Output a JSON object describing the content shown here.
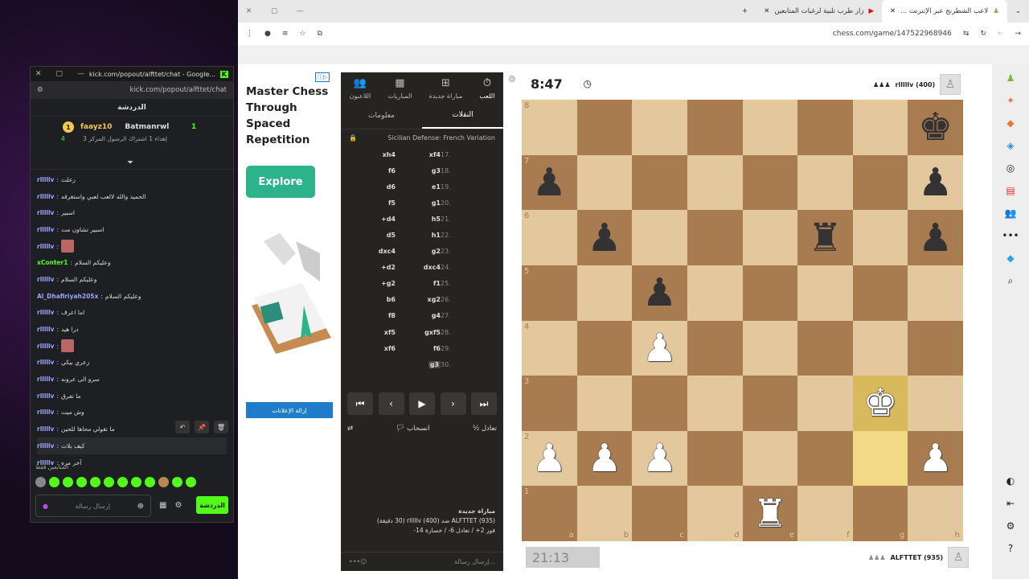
{
  "kick": {
    "window_title": "kick.com/popout/alfttet/chat - Google...",
    "url": "kick.com/popout/alfttet/chat",
    "header": "الدردشة",
    "pinned": {
      "rank": "1",
      "user1": "faayz10",
      "count1": "4",
      "user2": "Batmanrwl",
      "count2": "1",
      "gift_text": "إهداء 1 اشتراك الرسول المركز 3"
    },
    "messages": [
      {
        "user": "rlllllv",
        "text": "زعلت"
      },
      {
        "user": "rlllllv",
        "text": "الحميد والله لالعب لعبي واستغرقه"
      },
      {
        "user": "rlllllv",
        "text": "اسبير"
      },
      {
        "user": "rlllllv",
        "text": "اسبير تشاون مت"
      },
      {
        "user": "rlllllv",
        "text": ""
      },
      {
        "user": "xConter1",
        "text": "وعليكم السلام"
      },
      {
        "user": "rlllllv",
        "text": "وعليكم السلام"
      },
      {
        "user": "Al_Dhafiriyah205x",
        "text": "وعليكم السلام"
      },
      {
        "user": "rlllllv",
        "text": "اما اعرف"
      },
      {
        "user": "rlllllv",
        "text": "درا هيد"
      },
      {
        "user": "rlllllv",
        "text": ""
      },
      {
        "user": "rlllllv",
        "text": "زعري بيكي"
      },
      {
        "user": "rlllllv",
        "text": "سرو الى عرونه"
      },
      {
        "user": "rlllllv",
        "text": "ما تفرق"
      },
      {
        "user": "rlllllv",
        "text": "وش ميت"
      },
      {
        "user": "rlllllv",
        "text": "ما تقولي محاها للحين"
      },
      {
        "user": "rlllllv",
        "text": "كيف بلات"
      },
      {
        "user": "rlllllv",
        "text": "آخر مره"
      }
    ],
    "followers_label": "المتابعين فقط",
    "input_placeholder": "إرسال رسالة",
    "send_label": "الدردشة"
  },
  "browser": {
    "tabs": [
      {
        "label": "لاعب الشطرنج عبر الإنترنت ..."
      },
      {
        "label": "زار طرب تلبية لرغبات المتابعين"
      }
    ],
    "url": "chess.com/game/147522968946"
  },
  "ad": {
    "headline": "Master Chess Through Spaced Repetition",
    "button": "Explore",
    "remove": "إزالة الإعلانات"
  },
  "panel": {
    "tabs": [
      {
        "label": "اللعب",
        "icon": "stopwatch-icon"
      },
      {
        "label": "مباراة جديدة",
        "icon": "plus-icon"
      },
      {
        "label": "المباريات",
        "icon": "board-icon"
      },
      {
        "label": "اللاعبون",
        "icon": "players-icon"
      }
    ],
    "subtabs": [
      "النقلات",
      "معلومات"
    ],
    "opening": "Sicilian Defense: French Variation",
    "moves": [
      {
        "n": "17.",
        "w": "xf4",
        "b": "xh4"
      },
      {
        "n": "18.",
        "w": "g3",
        "b": "f6"
      },
      {
        "n": "19.",
        "w": "e1",
        "b": "d6"
      },
      {
        "n": "20.",
        "w": "g1",
        "b": "f5"
      },
      {
        "n": "21.",
        "w": "h5",
        "b": "+d4"
      },
      {
        "n": "22.",
        "w": "h1",
        "b": "d5"
      },
      {
        "n": "23.",
        "w": "g2",
        "b": "dxc4"
      },
      {
        "n": "24.",
        "w": "dxc4",
        "b": "+d2"
      },
      {
        "n": "25.",
        "w": "f1",
        "b": "+g2"
      },
      {
        "n": "26.",
        "w": "xg2",
        "b": "b6"
      },
      {
        "n": "27.",
        "w": "g4",
        "b": "f8"
      },
      {
        "n": "28.",
        "w": "gxf5",
        "b": "xf5"
      },
      {
        "n": "29.",
        "w": "f6",
        "b": "xf6"
      },
      {
        "n": "30.",
        "w": "g3",
        "b": ""
      }
    ],
    "draw": "تعادل",
    "resign": "انسحاب",
    "game_title": "مباراة جديدة",
    "game_line": "ALFTTET (935) ضد rlllllv (400) (30 دقيقة)",
    "result_line": "فوز 2+ / تعادل 6- / خسارة 14-",
    "chat_placeholder": "إرسال رسالة..."
  },
  "game": {
    "top_clock": "8:47",
    "bottom_clock": "21:13",
    "top_player": "rlllllv (400)",
    "bottom_player": "ALFTTET (935)",
    "files": [
      "a",
      "b",
      "c",
      "d",
      "e",
      "f",
      "g",
      "h"
    ],
    "ranks": [
      "8",
      "7",
      "6",
      "5",
      "4",
      "3",
      "2",
      "1"
    ],
    "position": [
      [
        "",
        "",
        "",
        "",
        "",
        "",
        "",
        "bK"
      ],
      [
        "bP",
        "",
        "",
        "",
        "",
        "",
        "",
        "bP"
      ],
      [
        "",
        "bP",
        "",
        "",
        "",
        "bR",
        "",
        "bP"
      ],
      [
        "",
        "",
        "bP",
        "",
        "",
        "",
        "",
        ""
      ],
      [
        "",
        "",
        "wP",
        "",
        "",
        "",
        "",
        ""
      ],
      [
        "",
        "",
        "",
        "",
        "",
        "",
        "wK",
        ""
      ],
      [
        "wP",
        "wP",
        "wP",
        "",
        "",
        "",
        "",
        "wP"
      ],
      [
        "",
        "",
        "",
        "",
        "wR",
        "",
        "",
        ""
      ]
    ],
    "highlight": [
      "g3",
      "g2"
    ]
  }
}
